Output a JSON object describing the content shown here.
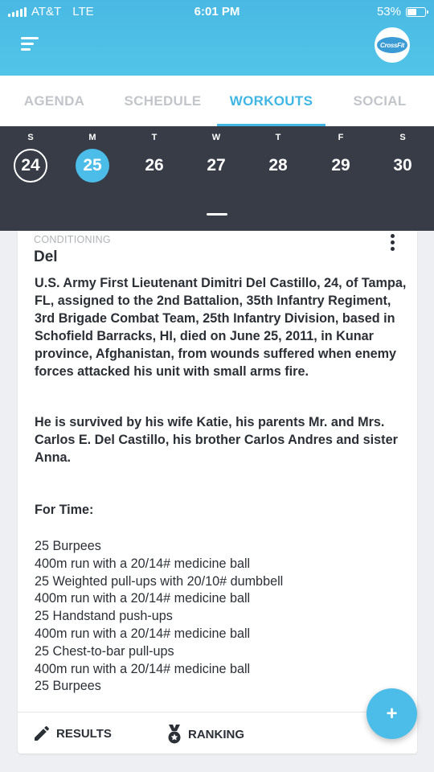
{
  "status_bar": {
    "carrier": "AT&T",
    "network": "LTE",
    "time": "6:01 PM",
    "battery": "53%",
    "battery_level": 0.53
  },
  "header": {
    "menu_icon": "hamburger-icon",
    "logo_text": "CrossFit"
  },
  "tabs": [
    {
      "label": "AGENDA",
      "active": false
    },
    {
      "label": "SCHEDULE",
      "active": false
    },
    {
      "label": "WORKOUTS",
      "active": true
    },
    {
      "label": "SOCIAL",
      "active": false
    }
  ],
  "week": {
    "days": [
      {
        "dow": "S",
        "num": "24",
        "state": "today"
      },
      {
        "dow": "M",
        "num": "25",
        "state": "selected"
      },
      {
        "dow": "T",
        "num": "26",
        "state": ""
      },
      {
        "dow": "W",
        "num": "27",
        "state": ""
      },
      {
        "dow": "T",
        "num": "28",
        "state": ""
      },
      {
        "dow": "F",
        "num": "29",
        "state": ""
      },
      {
        "dow": "S",
        "num": "30",
        "state": ""
      }
    ]
  },
  "workout": {
    "category": "CONDITIONING",
    "title": "Del",
    "description": "U.S. Army First Lieutenant Dimitri Del Castillo, 24, of Tampa, FL, assigned to the 2nd Battalion, 35th Infantry Regiment, 3rd Brigade Combat Team, 25th Infantry Division, based in Schofield Barracks, HI, died on June 25, 2011, in Kunar province, Afghanistan, from wounds suffered when enemy forces attacked his unit with small arms fire.",
    "survived": "He is survived by his wife Katie, his parents Mr. and Mrs. Carlos E. Del Castillo, his brother Carlos Andres and sister Anna.",
    "scoring": "For Time:",
    "movements": [
      "25 Burpees",
      "400m run with a 20/14# medicine ball",
      "25 Weighted pull-ups with 20/10# dumbbell",
      "400m run with a 20/14# medicine ball",
      "25 Handstand push-ups",
      "400m run with a 20/14# medicine ball",
      "25 Chest-to-bar pull-ups",
      "400m run with a 20/14# medicine ball",
      "25 Burpees"
    ],
    "actions": {
      "results_label": "RESULTS",
      "ranking_label": "RANKING"
    }
  },
  "fab": {
    "label": "+"
  },
  "colors": {
    "accent": "#4bbde8",
    "header": "#52c4e8",
    "week_bg": "#373c47",
    "text": "#2b2f36"
  }
}
